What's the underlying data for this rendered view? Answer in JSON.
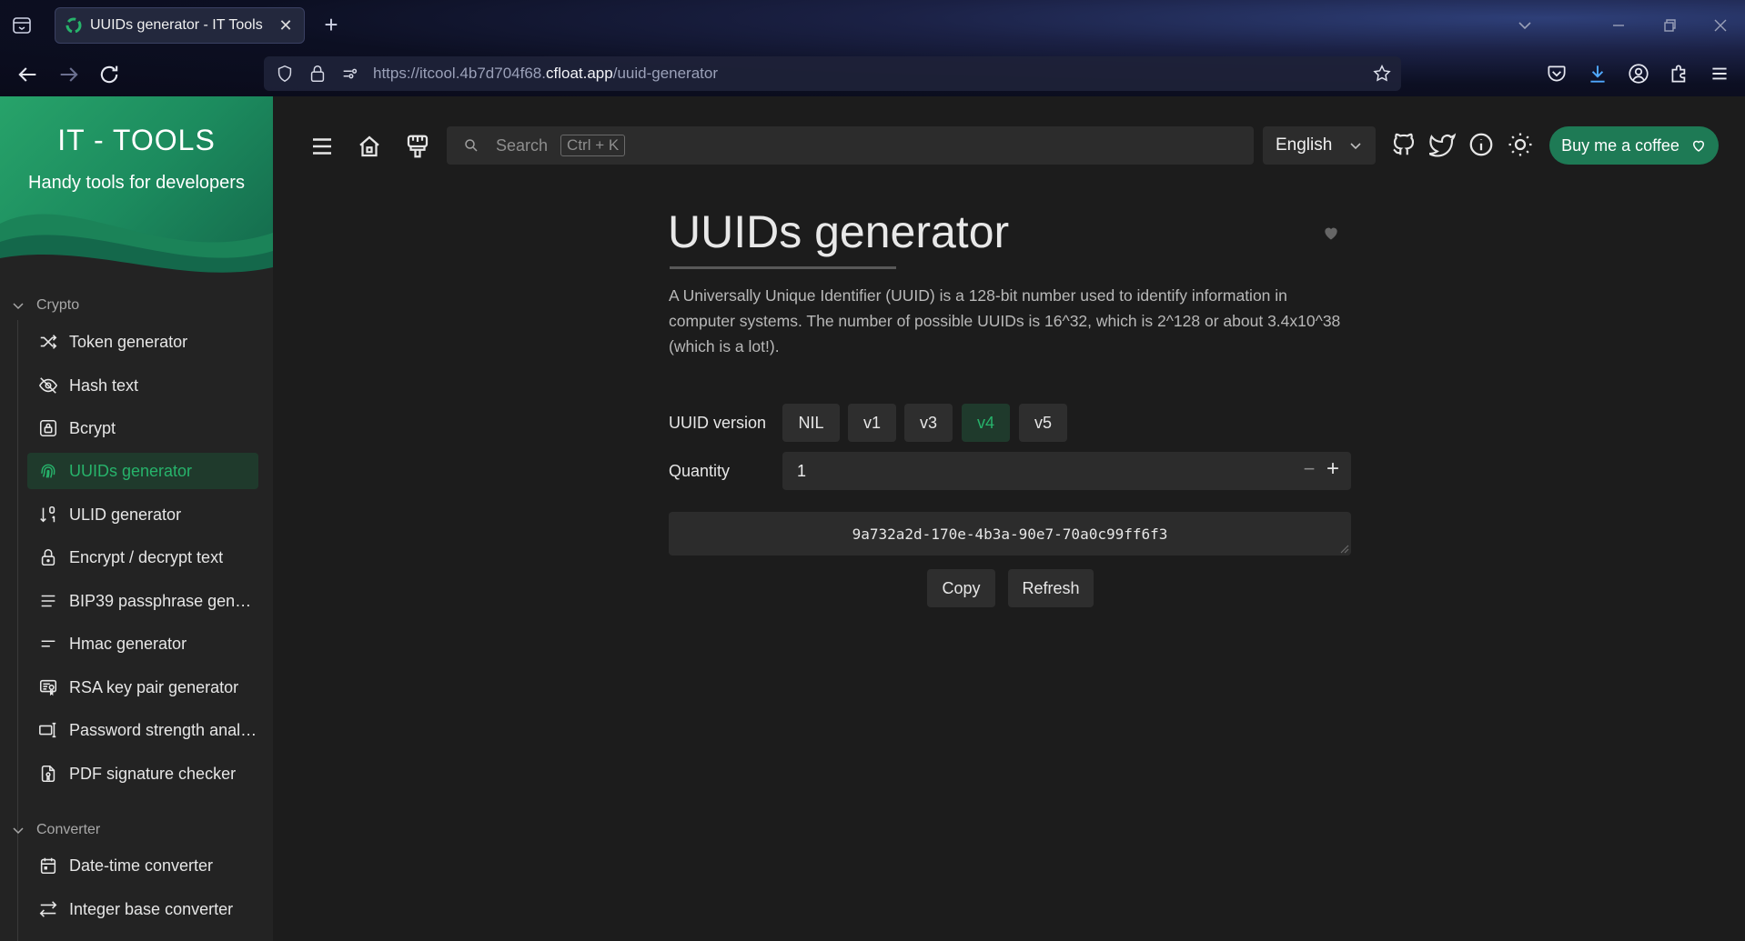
{
  "browser": {
    "tab_title": "UUIDs generator - IT Tools",
    "tab_close": "✕",
    "new_tab": "+",
    "url_prefix": "https://itcool.4b7d704f68.",
    "url_domain": "cfloat.app",
    "url_path": "/uuid-generator"
  },
  "sidebar": {
    "brand": "IT - TOOLS",
    "tagline": "Handy tools for developers",
    "groups": [
      {
        "title": "Crypto",
        "items": [
          {
            "label": "Token generator",
            "icon": "shuffle-icon"
          },
          {
            "label": "Hash text",
            "icon": "eye-off-icon"
          },
          {
            "label": "Bcrypt",
            "icon": "lock-square-icon"
          },
          {
            "label": "UUIDs generator",
            "icon": "fingerprint-icon",
            "active": true
          },
          {
            "label": "ULID generator",
            "icon": "sort-numeric-icon"
          },
          {
            "label": "Encrypt / decrypt text",
            "icon": "lock-icon"
          },
          {
            "label": "BIP39 passphrase gener...",
            "icon": "text-lines-icon"
          },
          {
            "label": "Hmac generator",
            "icon": "short-text-icon"
          },
          {
            "label": "RSA key pair generator",
            "icon": "certificate-icon"
          },
          {
            "label": "Password strength analy...",
            "icon": "password-icon"
          },
          {
            "label": "PDF signature checker",
            "icon": "file-certificate-icon"
          }
        ]
      },
      {
        "title": "Converter",
        "items": [
          {
            "label": "Date-time converter",
            "icon": "calendar-icon"
          },
          {
            "label": "Integer base converter",
            "icon": "arrows-left-right-icon"
          }
        ]
      }
    ]
  },
  "appbar": {
    "search_placeholder": "Search",
    "search_shortcut": "Ctrl + K",
    "language": "English",
    "coffee_label": "Buy me a coffee"
  },
  "tool": {
    "title": "UUIDs generator",
    "description": "A Universally Unique Identifier (UUID) is a 128-bit number used to identify information in computer systems. The number of possible UUIDs is 16^32, which is 2^128 or about 3.4x10^38 (which is a lot!).",
    "version_label": "UUID version",
    "versions": [
      "NIL",
      "v1",
      "v3",
      "v4",
      "v5"
    ],
    "selected_version": "v4",
    "quantity_label": "Quantity",
    "quantity": "1",
    "qty_minus": "−",
    "qty_plus": "+",
    "result": "9a732a2d-170e-4b3a-90e7-70a0c99ff6f3",
    "copy_label": "Copy",
    "refresh_label": "Refresh"
  },
  "colors": {
    "accent": "#27b36b",
    "accent_bg": "#1f3a2c",
    "coffee": "#1e7a55"
  }
}
